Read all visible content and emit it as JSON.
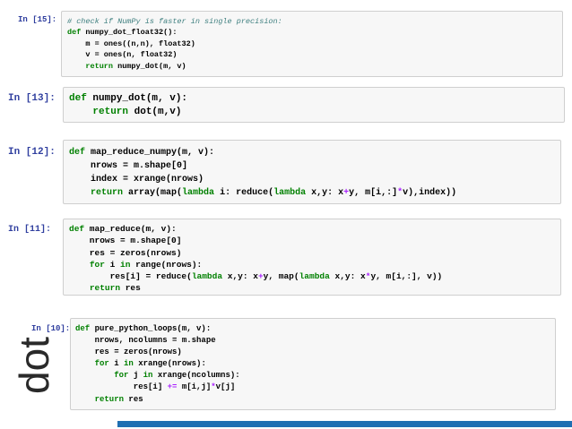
{
  "cells": [
    {
      "prompt": "In [15]:",
      "lines": [
        [
          {
            "t": "# check if NumPy is faster in single precision:",
            "c": "cm"
          }
        ],
        [
          {
            "t": "def",
            "c": "kw"
          },
          {
            "t": " numpy_dot_float32():"
          }
        ],
        [
          {
            "t": "    m = ones((n,n), float32)"
          }
        ],
        [
          {
            "t": "    v = ones(n, float32)"
          }
        ],
        [
          {
            "t": "    "
          },
          {
            "t": "return",
            "c": "kw"
          },
          {
            "t": " numpy_dot(m, v)"
          }
        ]
      ]
    },
    {
      "prompt": "In [13]:",
      "lines": [
        [
          {
            "t": "def",
            "c": "kw"
          },
          {
            "t": " numpy_dot(m, v):"
          }
        ],
        [
          {
            "t": "    "
          },
          {
            "t": "return",
            "c": "kw"
          },
          {
            "t": " dot(m,v)"
          }
        ]
      ]
    },
    {
      "prompt": "In [12]:",
      "lines": [
        [
          {
            "t": "def",
            "c": "kw"
          },
          {
            "t": " map_reduce_numpy(m, v):"
          }
        ],
        [
          {
            "t": "    nrows = m.shape[0]"
          }
        ],
        [
          {
            "t": "    index = xrange(nrows)"
          }
        ],
        [
          {
            "t": "    "
          },
          {
            "t": "return",
            "c": "kw"
          },
          {
            "t": " array(map("
          },
          {
            "t": "lambda",
            "c": "kw"
          },
          {
            "t": " i: reduce("
          },
          {
            "t": "lambda",
            "c": "kw"
          },
          {
            "t": " x,y: x"
          },
          {
            "t": "+",
            "c": "op"
          },
          {
            "t": "y, m[i,:]"
          },
          {
            "t": "*",
            "c": "op"
          },
          {
            "t": "v),index))"
          }
        ]
      ]
    },
    {
      "prompt": "In [11]:",
      "lines": [
        [
          {
            "t": "def",
            "c": "kw"
          },
          {
            "t": " map_reduce(m, v):"
          }
        ],
        [
          {
            "t": "    nrows = m.shape[0]"
          }
        ],
        [
          {
            "t": "    res = zeros(nrows)"
          }
        ],
        [
          {
            "t": "    "
          },
          {
            "t": "for",
            "c": "kw"
          },
          {
            "t": " i "
          },
          {
            "t": "in",
            "c": "kw"
          },
          {
            "t": " range(nrows):"
          }
        ],
        [
          {
            "t": "        res[i] = reduce("
          },
          {
            "t": "lambda",
            "c": "kw"
          },
          {
            "t": " x,y: x"
          },
          {
            "t": "+",
            "c": "op"
          },
          {
            "t": "y, map("
          },
          {
            "t": "lambda",
            "c": "kw"
          },
          {
            "t": " x,y: x"
          },
          {
            "t": "*",
            "c": "op"
          },
          {
            "t": "y, m[i,:], v))"
          }
        ],
        [
          {
            "t": "    "
          },
          {
            "t": "return",
            "c": "kw"
          },
          {
            "t": " res"
          }
        ]
      ]
    },
    {
      "prompt": "In [10]:",
      "lines": [
        [
          {
            "t": "def",
            "c": "kw"
          },
          {
            "t": " pure_python_loops(m, v):"
          }
        ],
        [
          {
            "t": "    nrows, ncolumns = m.shape"
          }
        ],
        [
          {
            "t": "    res = zeros(nrows)"
          }
        ],
        [
          {
            "t": "    "
          },
          {
            "t": "for",
            "c": "kw"
          },
          {
            "t": " i "
          },
          {
            "t": "in",
            "c": "kw"
          },
          {
            "t": " xrange(nrows):"
          }
        ],
        [
          {
            "t": "        "
          },
          {
            "t": "for",
            "c": "kw"
          },
          {
            "t": " j "
          },
          {
            "t": "in",
            "c": "kw"
          },
          {
            "t": " xrange(ncolumns):"
          }
        ],
        [
          {
            "t": "            res[i] "
          },
          {
            "t": "+=",
            "c": "op"
          },
          {
            "t": " m[i,j]"
          },
          {
            "t": "*",
            "c": "op"
          },
          {
            "t": "v[j]"
          }
        ],
        [
          {
            "t": "    "
          },
          {
            "t": "return",
            "c": "kw"
          },
          {
            "t": " res"
          }
        ]
      ]
    }
  ],
  "side_label": "dot",
  "colors": {
    "keyword": "#008000",
    "operator": "#AA22FF",
    "comment": "#408080",
    "prompt": "#303F9F",
    "accent_bar": "#1f6fb2"
  }
}
